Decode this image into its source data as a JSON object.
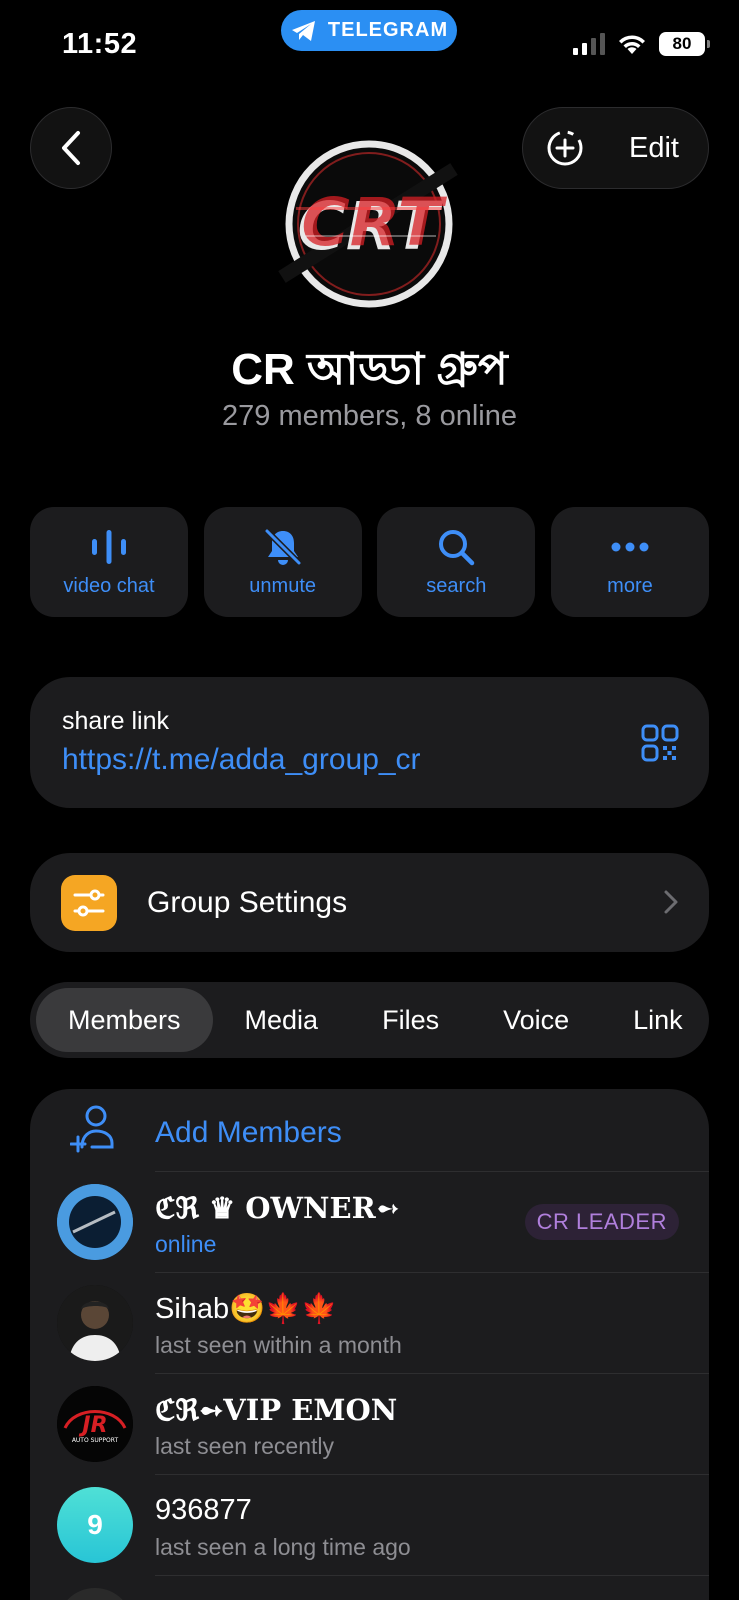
{
  "status_bar": {
    "time": "11:52",
    "pill_label": "TELEGRAM",
    "battery": "80"
  },
  "header": {
    "edit_label": "Edit"
  },
  "group": {
    "title": "CR আড্ডা গ্রুপ",
    "subtitle": "279 members, 8 online"
  },
  "actions": [
    {
      "label": "video chat",
      "icon": "voice-chat-icon"
    },
    {
      "label": "unmute",
      "icon": "muted-bell-icon"
    },
    {
      "label": "search",
      "icon": "search-icon"
    },
    {
      "label": "more",
      "icon": "more-dots-icon"
    }
  ],
  "share_link": {
    "title": "share link",
    "url": "https://t.me/adda_group_cr"
  },
  "settings": {
    "label": "Group Settings"
  },
  "tabs": [
    "Members",
    "Media",
    "Files",
    "Voice",
    "Link"
  ],
  "members_section": {
    "add_label": "Add Members",
    "members": [
      {
        "name_prefix": "ℭℜ ♛ ",
        "name_main": "OWNER",
        "name_suffix": "➻",
        "status": "online",
        "badge": "CR LEADER"
      },
      {
        "name_prefix": "",
        "name_main": "Sihab🤩🍁🍁",
        "name_suffix": "",
        "status": "last seen within a month"
      },
      {
        "name_prefix": "ℭℜ➻",
        "name_main": "VIP EMON",
        "name_suffix": "",
        "status": "last seen recently",
        "avatar_text": "JR",
        "avatar_sub": "AUTO SUPPORT"
      },
      {
        "name_prefix": "",
        "name_main": "936877",
        "name_suffix": "",
        "status": "last seen a long time ago",
        "avatar_text": "9"
      }
    ]
  },
  "colors": {
    "accent": "#3e8ef7",
    "background": "#000000",
    "card": "#1c1c1e",
    "badge_text": "#b07fdc",
    "settings_icon": "#f5a623"
  }
}
